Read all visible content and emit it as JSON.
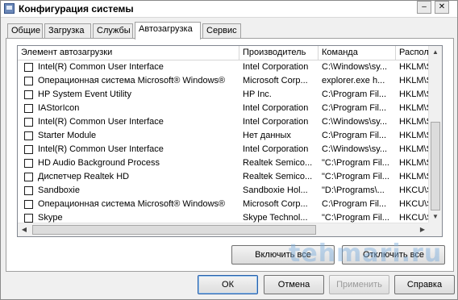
{
  "window": {
    "title": "Конфигурация системы"
  },
  "tabs": [
    {
      "label": "Общие",
      "active": false
    },
    {
      "label": "Загрузка",
      "active": false
    },
    {
      "label": "Службы",
      "active": false
    },
    {
      "label": "Автозагрузка",
      "active": true
    },
    {
      "label": "Сервис",
      "active": false
    }
  ],
  "table": {
    "columns": [
      "Элемент автозагрузки",
      "Производитель",
      "Команда",
      "Располо"
    ],
    "rows": [
      {
        "item": "Intel(R) Common User Interface",
        "maker": "Intel Corporation",
        "command": "C:\\Windows\\sy...",
        "location": "HKLM\\SO",
        "checked": false
      },
      {
        "item": "Операционная система Microsoft® Windows®",
        "maker": "Microsoft Corp...",
        "command": "explorer.exe h...",
        "location": "HKLM\\SO",
        "checked": false
      },
      {
        "item": "HP System Event Utility",
        "maker": "HP Inc.",
        "command": "C:\\Program Fil...",
        "location": "HKLM\\SO",
        "checked": false
      },
      {
        "item": "IAStorIcon",
        "maker": "Intel Corporation",
        "command": "C:\\Program Fil...",
        "location": "HKLM\\SO",
        "checked": false
      },
      {
        "item": "Intel(R) Common User Interface",
        "maker": "Intel Corporation",
        "command": "C:\\Windows\\sy...",
        "location": "HKLM\\SO",
        "checked": false
      },
      {
        "item": "Starter Module",
        "maker": "Нет данных",
        "command": "C:\\Program Fil...",
        "location": "HKLM\\SO",
        "checked": false
      },
      {
        "item": "Intel(R) Common User Interface",
        "maker": "Intel Corporation",
        "command": "C:\\Windows\\sy...",
        "location": "HKLM\\SO",
        "checked": false
      },
      {
        "item": "HD Audio Background Process",
        "maker": "Realtek Semico...",
        "command": "\"C:\\Program Fil...",
        "location": "HKLM\\SO",
        "checked": false
      },
      {
        "item": "Диспетчер Realtek HD",
        "maker": "Realtek Semico...",
        "command": "\"C:\\Program Fil...",
        "location": "HKLM\\SO",
        "checked": false
      },
      {
        "item": "Sandboxie",
        "maker": "Sandboxie Hol...",
        "command": "\"D:\\Programs\\...",
        "location": "HKCU\\SO",
        "checked": false
      },
      {
        "item": "Операционная система Microsoft® Windows®",
        "maker": "Microsoft Corp...",
        "command": "C:\\Program Fil...",
        "location": "HKCU\\SO",
        "checked": false
      },
      {
        "item": "Skype",
        "maker": "Skype Technol...",
        "command": "\"C:\\Program Fil...",
        "location": "HKCU\\SO",
        "checked": false
      }
    ]
  },
  "buttons": {
    "enable_all": "Включить все",
    "disable_all": "Отключить все",
    "ok": "ОК",
    "cancel": "Отмена",
    "apply": "Применить",
    "help": "Справка"
  },
  "watermark": "tehmari.ru"
}
